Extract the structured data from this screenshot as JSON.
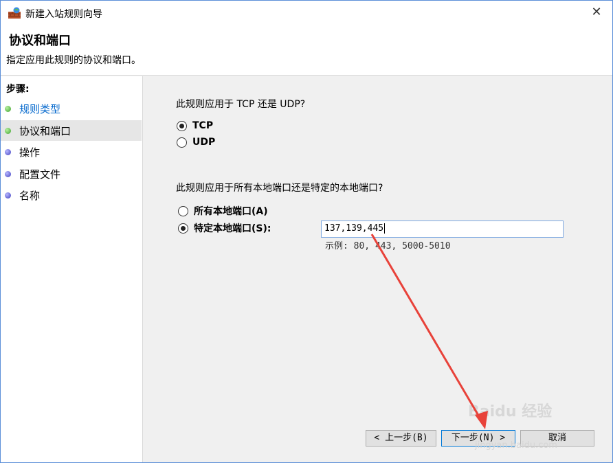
{
  "window": {
    "title": "新建入站规则向导",
    "close_glyph": "✕"
  },
  "header": {
    "title": "协议和端口",
    "subtitle": "指定应用此规则的协议和端口。"
  },
  "sidebar": {
    "steps_label": "步骤:",
    "items": [
      {
        "label": "规则类型",
        "bullet": "green",
        "state": "link"
      },
      {
        "label": "协议和端口",
        "bullet": "green",
        "state": "active"
      },
      {
        "label": "操作",
        "bullet": "blue",
        "state": "normal"
      },
      {
        "label": "配置文件",
        "bullet": "blue",
        "state": "normal"
      },
      {
        "label": "名称",
        "bullet": "blue",
        "state": "normal"
      }
    ]
  },
  "main": {
    "protocol_question": "此规则应用于 TCP 还是 UDP?",
    "protocol_options": [
      {
        "label": "TCP",
        "checked": true
      },
      {
        "label": "UDP",
        "checked": false
      }
    ],
    "port_question": "此规则应用于所有本地端口还是特定的本地端口?",
    "port_options": [
      {
        "label": "所有本地端口(A)",
        "checked": false
      },
      {
        "label": "特定本地端口(S):",
        "checked": true
      }
    ],
    "port_value": "137,139,445",
    "example_text": "示例: 80, 443, 5000-5010"
  },
  "buttons": {
    "back": "< 上一步(B)",
    "next": "下一步(N) >",
    "cancel": "取消"
  },
  "watermark": {
    "text": "Baidu 经验",
    "sub": "jingyan.baidu.com"
  },
  "colors": {
    "accent": "#0078d7",
    "link": "#0066cc",
    "arrow": "#e8423a"
  }
}
